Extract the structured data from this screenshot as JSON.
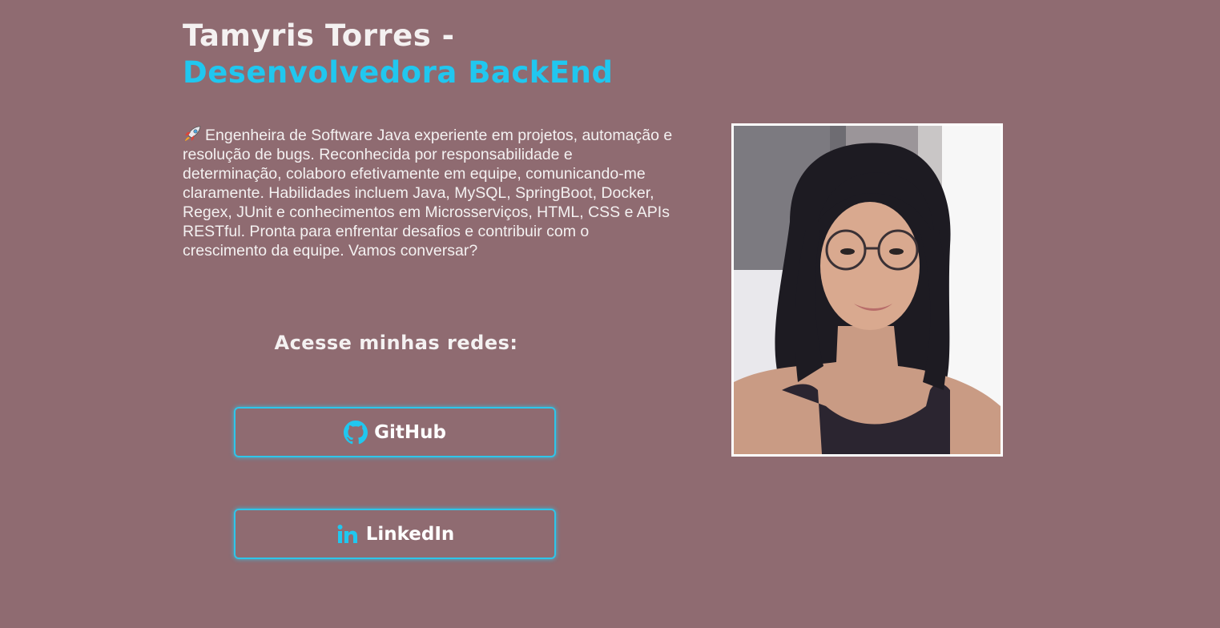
{
  "header": {
    "name": "Tamyris Torres -",
    "role": "Desenvolvedora BackEnd"
  },
  "bio": {
    "icon": "rocket-icon",
    "text": "Engenheira de Software Java experiente em projetos, automação e resolução de bugs. Reconhecida por responsabilidade e determinação, colaboro efetivamente em equipe, comunicando-me claramente. Habilidades incluem Java, MySQL, SpringBoot, Docker, Regex, JUnit e conhecimentos em Microsserviços, HTML, CSS e APIs RESTful. Pronta para enfrentar desafios e contribuir com o crescimento da equipe. Vamos conversar?"
  },
  "networks": {
    "title": "Acesse minhas redes:",
    "links": [
      {
        "label": "GitHub",
        "icon": "github-icon"
      },
      {
        "label": "LinkedIn",
        "icon": "linkedin-icon"
      }
    ]
  },
  "colors": {
    "background": "#8f6b71",
    "accent": "#20c7ef",
    "text": "#f4f1f1"
  }
}
